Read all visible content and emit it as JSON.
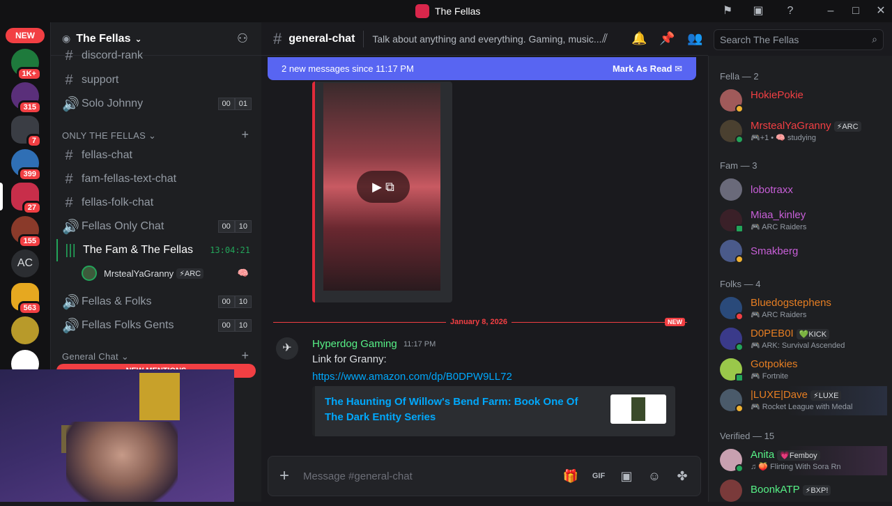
{
  "window": {
    "title": "The Fellas"
  },
  "rail": {
    "new_label": "NEW",
    "badges": [
      "1K+",
      "315",
      "7",
      "399",
      "27",
      "155",
      "563"
    ],
    "initials": "AC"
  },
  "sidebar": {
    "server_name": "The Fellas",
    "channels_top": [
      {
        "name": "discord-rank",
        "type": "text"
      },
      {
        "name": "support",
        "type": "text"
      },
      {
        "name": "Solo Johnny",
        "type": "voice",
        "count": [
          "00",
          "01"
        ]
      }
    ],
    "category_only": "ONLY THE FELLAS",
    "channels_only": [
      {
        "name": "fellas-chat",
        "type": "text"
      },
      {
        "name": "fam-fellas-text-chat",
        "type": "text"
      },
      {
        "name": "fellas-folk-chat",
        "type": "text"
      },
      {
        "name": "Fellas Only Chat",
        "type": "voice",
        "count": [
          "00",
          "10"
        ]
      },
      {
        "name": "The Fam & The Fellas",
        "type": "voice-active",
        "time": "13:04:21"
      },
      {
        "name": "Fellas & Folks",
        "type": "voice",
        "count": [
          "00",
          "10"
        ]
      },
      {
        "name": "Fellas Folks Gents",
        "type": "voice",
        "count": [
          "00",
          "10"
        ]
      }
    ],
    "voice_user": {
      "name": "MrstealYaGranny",
      "tag": "ARC"
    },
    "category_general": "General Chat",
    "new_mentions": "NEW MENTIONS"
  },
  "header": {
    "channel": "general-chat",
    "topic": "Talk about anything and everything. Gaming, music...",
    "search_placeholder": "Search The Fellas"
  },
  "banner": {
    "text": "2 new messages since 11:17 PM",
    "action": "Mark As Read"
  },
  "messages": {
    "divider_date": "January 8, 2026",
    "divider_new": "NEW",
    "author": "Hyperdog Gaming",
    "time": "11:17 PM",
    "text": "Link for Granny:",
    "url": "https://www.amazon.com/dp/B0DPW9LL72",
    "embed_title": "The Haunting Of Willow's Bend Farm: Book One Of The Dark Entity Series"
  },
  "composer": {
    "placeholder": "Message #general-chat"
  },
  "members": {
    "groups": [
      {
        "label": "Fella — 2",
        "members": [
          {
            "name": "HokiePokie",
            "color": "#f23f43",
            "status": "",
            "tag": ""
          },
          {
            "name": "MrstealYaGranny",
            "color": "#f23f43",
            "status": "+1 • 🧠 studying",
            "tag": "ARC"
          }
        ]
      },
      {
        "label": "Fam — 3",
        "members": [
          {
            "name": "lobotraxx",
            "color": "#c85fd8",
            "status": "",
            "tag": ""
          },
          {
            "name": "Miaa_kinley",
            "color": "#c85fd8",
            "status": "ARC Raiders",
            "tag": ""
          },
          {
            "name": "Smakberg",
            "color": "#c85fd8",
            "status": "",
            "tag": ""
          }
        ]
      },
      {
        "label": "Folks — 4",
        "members": [
          {
            "name": "Bluedogstephens",
            "color": "#e67e22",
            "status": "ARC Raiders",
            "tag": ""
          },
          {
            "name": "D0PEB0I",
            "color": "#e67e22",
            "status": "ARK: Survival Ascended",
            "tag": "KICK"
          },
          {
            "name": "Gotpokies",
            "color": "#e67e22",
            "status": "Fortnite",
            "tag": ""
          },
          {
            "name": "|LUXE|Dave",
            "color": "#e67e22",
            "status": "Rocket League with Medal",
            "tag": "LUXE"
          }
        ]
      },
      {
        "label": "Verified — 15",
        "members": [
          {
            "name": "Anita",
            "color": "#57f287",
            "status": "Flirting With Sora Rn",
            "tag": "Femboy"
          },
          {
            "name": "BoonkATP",
            "color": "#57f287",
            "status": "",
            "tag": "BXP!"
          }
        ]
      }
    ]
  }
}
